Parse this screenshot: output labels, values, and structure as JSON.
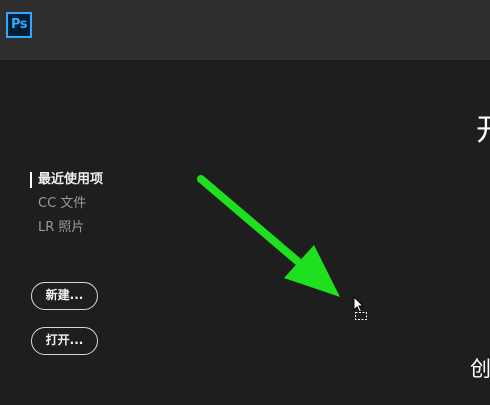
{
  "app": {
    "logo_text": "Ps",
    "accent": "#31a8ff"
  },
  "sidebar": {
    "items": [
      {
        "label": "最近使用项",
        "active": true
      },
      {
        "label": "CC 文件",
        "active": false
      },
      {
        "label": "LR 照片",
        "active": false
      }
    ],
    "new_button": "新建...",
    "open_button": "打开..."
  },
  "main": {
    "heading_partial": "开",
    "subheading_partial": "创"
  },
  "annotation": {
    "arrow_color": "#1ee01e",
    "icon": "arrow-annotation-icon"
  },
  "cursor": {
    "icon": "copy-cursor-icon"
  }
}
